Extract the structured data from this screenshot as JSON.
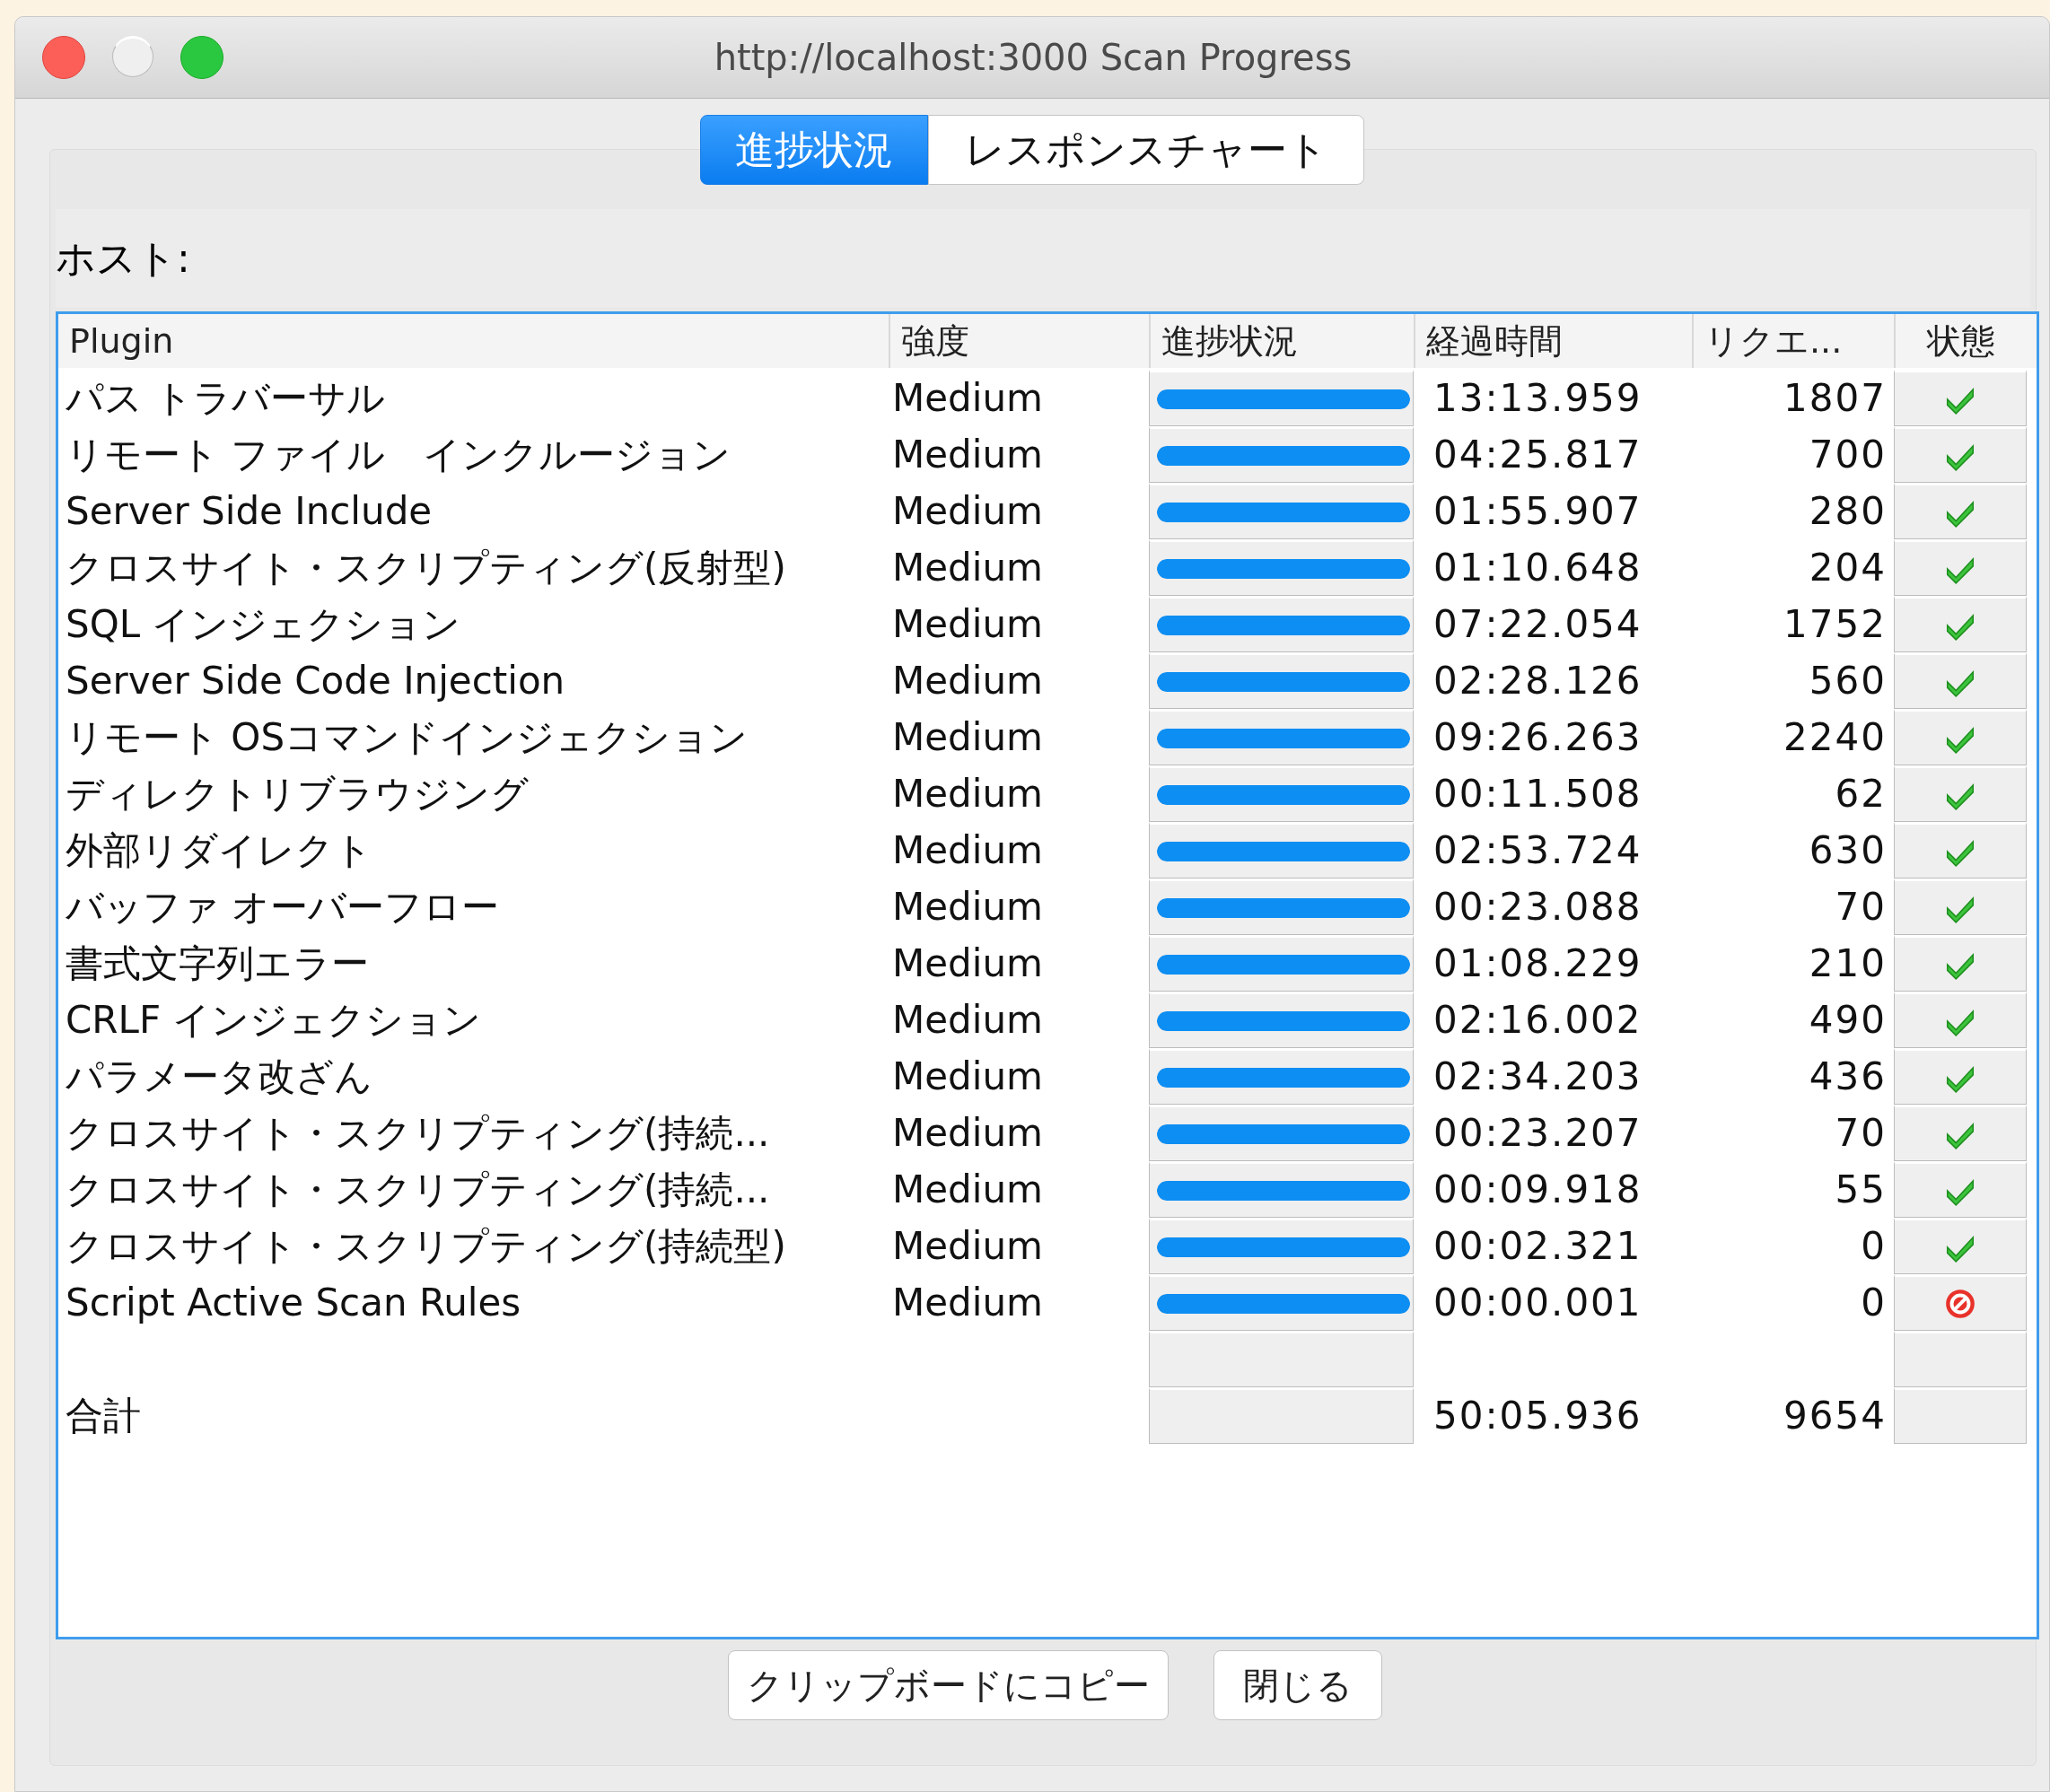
{
  "window": {
    "title": "http://localhost:3000 Scan Progress"
  },
  "tabs": [
    {
      "label": "進捗状況",
      "selected": true
    },
    {
      "label": "レスポンスチャート",
      "selected": false
    }
  ],
  "host_label": "ホスト:",
  "table": {
    "columns": [
      "Plugin",
      "強度",
      "進捗状況",
      "経過時間",
      "リクエ...",
      "状態"
    ],
    "rows": [
      {
        "plugin": "パス トラバーサル",
        "strength": "Medium",
        "level": 1,
        "elapsed": "13:13.959",
        "requests": "1807",
        "completed": true
      },
      {
        "plugin": "リモート ファイル　インクルージョン",
        "strength": "Medium",
        "level": 1,
        "elapsed": "04:25.817",
        "requests": "700",
        "completed": true
      },
      {
        "plugin": "Server Side Include",
        "strength": "Medium",
        "level": 1,
        "elapsed": "01:55.907",
        "requests": "280",
        "completed": true
      },
      {
        "plugin": "クロスサイト・スクリプティング(反射型)",
        "strength": "Medium",
        "level": 1,
        "elapsed": "01:10.648",
        "requests": "204",
        "completed": true
      },
      {
        "plugin": "SQL インジェクション",
        "strength": "Medium",
        "level": 1,
        "elapsed": "07:22.054",
        "requests": "1752",
        "completed": true
      },
      {
        "plugin": "Server Side Code Injection",
        "strength": "Medium",
        "level": 1,
        "elapsed": "02:28.126",
        "requests": "560",
        "completed": true
      },
      {
        "plugin": "リモート OSコマンドインジェクション",
        "strength": "Medium",
        "level": 1,
        "elapsed": "09:26.263",
        "requests": "2240",
        "completed": true
      },
      {
        "plugin": "ディレクトリブラウジング",
        "strength": "Medium",
        "level": 1,
        "elapsed": "00:11.508",
        "requests": "62",
        "completed": true
      },
      {
        "plugin": "外部リダイレクト",
        "strength": "Medium",
        "level": 1,
        "elapsed": "02:53.724",
        "requests": "630",
        "completed": true
      },
      {
        "plugin": "バッファ オーバーフロー",
        "strength": "Medium",
        "level": 1,
        "elapsed": "00:23.088",
        "requests": "70",
        "completed": true
      },
      {
        "plugin": "書式文字列エラー",
        "strength": "Medium",
        "level": 1,
        "elapsed": "01:08.229",
        "requests": "210",
        "completed": true
      },
      {
        "plugin": "CRLF インジェクション",
        "strength": "Medium",
        "level": 1,
        "elapsed": "02:16.002",
        "requests": "490",
        "completed": true
      },
      {
        "plugin": "パラメータ改ざん",
        "strength": "Medium",
        "level": 1,
        "elapsed": "02:34.203",
        "requests": "436",
        "completed": true
      },
      {
        "plugin": "クロスサイト・スクリプティング(持続...",
        "strength": "Medium",
        "level": 1,
        "elapsed": "00:23.207",
        "requests": "70",
        "completed": true
      },
      {
        "plugin": "クロスサイト・スクリプティング(持続...",
        "strength": "Medium",
        "level": 1,
        "elapsed": "00:09.918",
        "requests": "55",
        "completed": true
      },
      {
        "plugin": "クロスサイト・スクリプティング(持続型)",
        "strength": "Medium",
        "level": 1,
        "elapsed": "00:02.321",
        "requests": "0",
        "completed": true
      },
      {
        "plugin": "Script Active Scan Rules",
        "strength": "Medium",
        "level": 1,
        "elapsed": "00:00.001",
        "requests": "0",
        "completed": false
      }
    ],
    "total": {
      "label": "合計",
      "elapsed": "50:05.936",
      "requests": "9654"
    }
  },
  "buttons": [
    "クリップボードにコピー",
    "閉じる"
  ]
}
